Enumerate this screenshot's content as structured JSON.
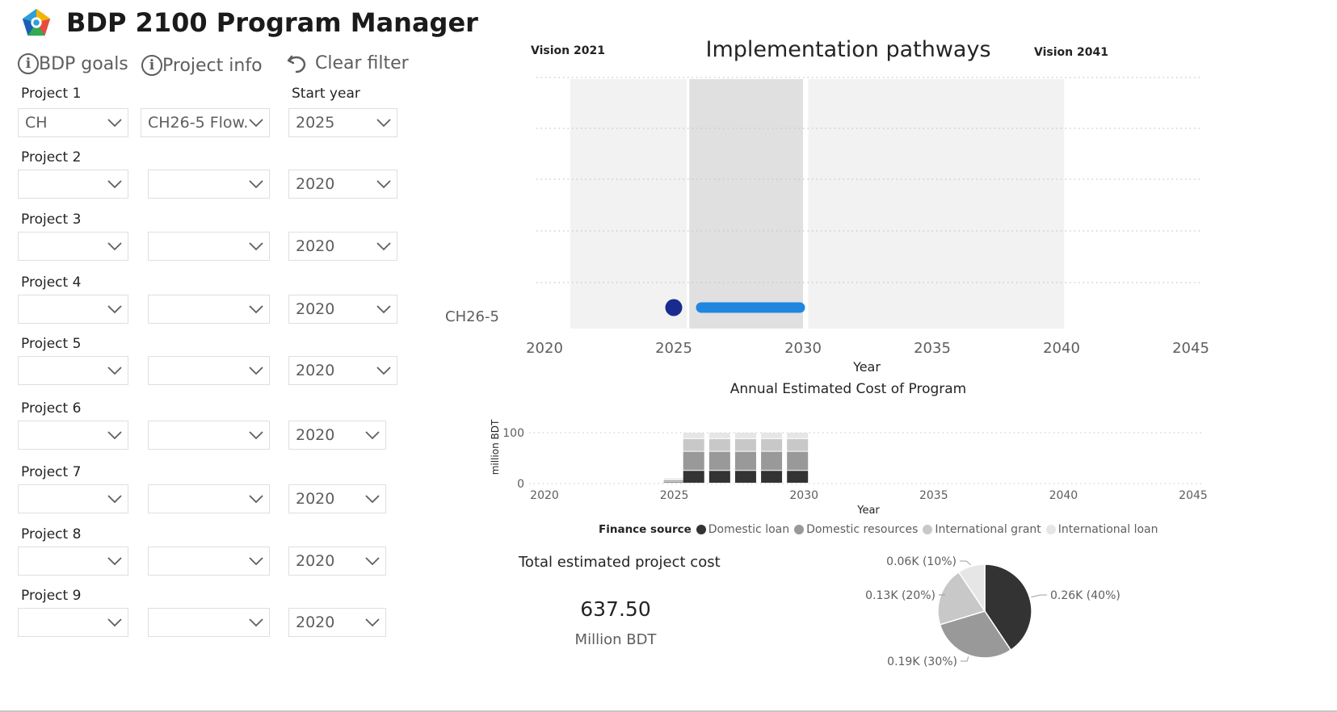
{
  "app": {
    "title": "BDP 2100 Program Manager"
  },
  "actions": {
    "goals": "BDP goals",
    "info": "Project info",
    "clear": "Clear filter"
  },
  "start_year_label": "Start year",
  "projects": [
    {
      "label": "Project 1",
      "region": "CH",
      "project": "CH26-5 Flow...",
      "year": "2025"
    },
    {
      "label": "Project 2",
      "region": "",
      "project": "",
      "year": "2020"
    },
    {
      "label": "Project 3",
      "region": "",
      "project": "",
      "year": "2020"
    },
    {
      "label": "Project 4",
      "region": "",
      "project": "",
      "year": "2020"
    },
    {
      "label": "Project 5",
      "region": "",
      "project": "",
      "year": "2020"
    },
    {
      "label": "Project 6",
      "region": "",
      "project": "",
      "year": "2020"
    },
    {
      "label": "Project 7",
      "region": "",
      "project": "",
      "year": "2020"
    },
    {
      "label": "Project 8",
      "region": "",
      "project": "",
      "year": "2020"
    },
    {
      "label": "Project 9",
      "region": "",
      "project": "",
      "year": "2020"
    }
  ],
  "pathways": {
    "title": "Implementation pathways",
    "vision_left": "Vision 2021",
    "vision_right": "Vision 2041",
    "row_label": "CH26-5",
    "x_label": "Year"
  },
  "cost_chart": {
    "title": "Annual Estimated Cost of Program",
    "y_label": "million BDT",
    "x_label": "Year",
    "legend_title": "Finance source",
    "total_label": "Total estimated project cost",
    "total_value": "637.50",
    "total_unit": "Million BDT"
  },
  "colors": {
    "band_light": "#f2f2f2",
    "band_dark": "#e0e0e0",
    "dot": "#1a2b8f",
    "bar": "#1f87e0",
    "domestic_loan": "#333333",
    "domestic_resources": "#999999",
    "international_grant": "#c8c8c8",
    "international_loan": "#e6e6e6"
  },
  "chart_data": [
    {
      "type": "scatter",
      "title": "Implementation pathways",
      "xlabel": "Year",
      "xlim": [
        2020,
        2045
      ],
      "x_ticks": [
        2020,
        2025,
        2030,
        2035,
        2040,
        2045
      ],
      "categories": [
        "CH26-5"
      ],
      "points": [
        {
          "category": "CH26-5",
          "x": 2025
        }
      ],
      "segments": [
        {
          "category": "CH26-5",
          "x_start": 2026,
          "x_end": 2030
        }
      ],
      "bands": [
        {
          "x_start": 2021,
          "x_end": 2025.5,
          "shade": "light"
        },
        {
          "x_start": 2025.6,
          "x_end": 2030,
          "shade": "dark"
        },
        {
          "x_start": 2030.2,
          "x_end": 2040.1,
          "shade": "light"
        }
      ]
    },
    {
      "type": "bar",
      "title": "Annual Estimated Cost of Program",
      "xlabel": "Year",
      "ylabel": "million BDT",
      "ylim": [
        0,
        130
      ],
      "y_ticks": [
        0,
        100
      ],
      "x_ticks": [
        2020,
        2025,
        2030,
        2035,
        2040,
        2045
      ],
      "x": [
        2025,
        2026,
        2027,
        2028,
        2029,
        2030
      ],
      "series": [
        {
          "name": "Domestic loan",
          "values": [
            2.5,
            25,
            25,
            25,
            25,
            25
          ]
        },
        {
          "name": "Domestic resources",
          "values": [
            3.75,
            37.5,
            37.5,
            37.5,
            37.5,
            37.5
          ]
        },
        {
          "name": "International grant",
          "values": [
            2.5,
            25,
            25,
            25,
            25,
            25
          ]
        },
        {
          "name": "International loan",
          "values": [
            1.25,
            12.5,
            12.5,
            12.5,
            12.5,
            12.5
          ]
        }
      ]
    },
    {
      "type": "pie",
      "categories": [
        "Domestic loan",
        "Domestic resources",
        "International grant",
        "International loan"
      ],
      "values": [
        0.26,
        0.19,
        0.13,
        0.06
      ],
      "labels": [
        "0.26K (40%)",
        "0.19K (30%)",
        "0.13K (20%)",
        "0.06K (10%)"
      ]
    }
  ]
}
